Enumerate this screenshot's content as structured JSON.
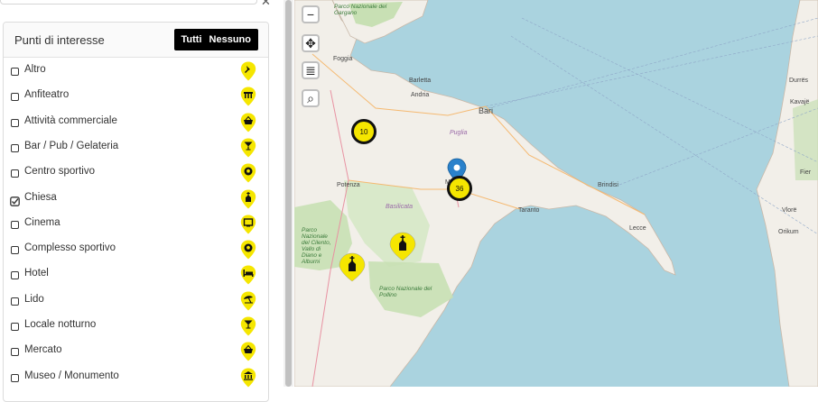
{
  "filter_panel": {
    "title": "Punti di interesse",
    "all_label": "Tutti",
    "none_label": "Nessuno",
    "items": [
      {
        "label": "Altro",
        "icon": "pushpin-icon",
        "checked": false
      },
      {
        "label": "Anfiteatro",
        "icon": "amphitheater-icon",
        "checked": false
      },
      {
        "label": "Attività commerciale",
        "icon": "shopping-basket-icon",
        "checked": false
      },
      {
        "label": "Bar / Pub / Gelateria",
        "icon": "cocktail-icon",
        "checked": false
      },
      {
        "label": "Centro sportivo",
        "icon": "soccer-ball-icon",
        "checked": false
      },
      {
        "label": "Chiesa",
        "icon": "church-icon",
        "checked": true
      },
      {
        "label": "Cinema",
        "icon": "screen-icon",
        "checked": false
      },
      {
        "label": "Complesso sportivo",
        "icon": "soccer-ball-icon",
        "checked": false
      },
      {
        "label": "Hotel",
        "icon": "bed-icon",
        "checked": false
      },
      {
        "label": "Lido",
        "icon": "beach-umbrella-icon",
        "checked": false
      },
      {
        "label": "Locale notturno",
        "icon": "cocktail-icon",
        "checked": false
      },
      {
        "label": "Mercato",
        "icon": "shopping-basket-icon",
        "checked": false
      },
      {
        "label": "Museo / Monumento",
        "icon": "museum-icon",
        "checked": false
      }
    ]
  },
  "map": {
    "controls": [
      "−",
      "✥",
      "≣",
      "⌕"
    ],
    "clusters": [
      "10",
      "36"
    ],
    "labels": {
      "gargano": "Parco Nazionale del Gargano",
      "foggia": "Foggia",
      "barletta": "Barletta",
      "andria": "Andria",
      "bari": "Bari",
      "puglia": "Puglia",
      "potenza": "Potenza",
      "basilicata": "Basilicata",
      "matera": "M",
      "brindisi": "Brindisi",
      "taranto": "Taranto",
      "lecce": "Lecce",
      "cilento": "Parco Nazionale del Cilento, Vallo di Diano e Alburni",
      "pollino": "Parco Nazionale del Pollino",
      "durres": "Durrës",
      "kavaje": "Kavajë",
      "fier": "Fier",
      "vlore": "Vlorë",
      "orikum": "Orikum"
    },
    "colors": {
      "sea": "#aad3df",
      "land": "#f2efe9",
      "park": "#c8e0b4",
      "cluster": "#f5e600",
      "pin": "#f5e600",
      "blue_marker": "#2a81cb"
    }
  }
}
